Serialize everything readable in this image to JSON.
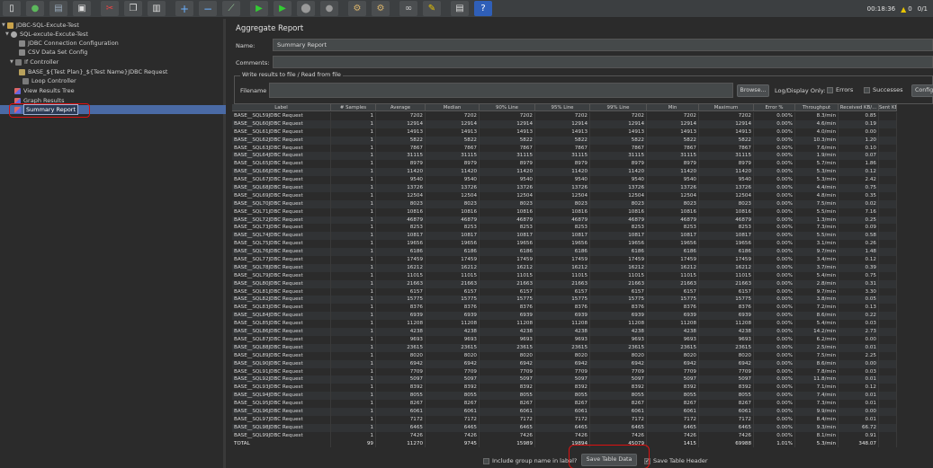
{
  "toolbar": {
    "icons": [
      "new-icon",
      "templates-icon",
      "open-icon",
      "save-icon",
      "cut-icon",
      "copy-icon",
      "paste-icon",
      "expand-icon",
      "collapse-icon",
      "toggle-icon",
      "start-icon",
      "start-no-pause-icon",
      "stop-icon",
      "shutdown-icon",
      "clear-icon",
      "clear-all-icon",
      "search-icon",
      "reset-search-icon",
      "function-helper-icon",
      "help-icon"
    ],
    "elapsed": "00:18:36",
    "warnings": "0",
    "threads": "0/1"
  },
  "tree": {
    "items": [
      {
        "label": "JDBC-SQL-Excute-Test",
        "depth": 0
      },
      {
        "label": "SQL-excute-Excute-Test",
        "depth": 1
      },
      {
        "label": "JDBC Connection Configuration",
        "depth": 2
      },
      {
        "label": "CSV Data Set Config",
        "depth": 2
      },
      {
        "label": "If Controller",
        "depth": 2
      },
      {
        "label": "BASE_${Test Plan}_${Test Name}JDBC Request",
        "depth": 3
      },
      {
        "label": "Loop Controller",
        "depth": 3
      },
      {
        "label": "View Results Tree",
        "depth": 2
      },
      {
        "label": "Graph Results",
        "depth": 2
      },
      {
        "label": "Summary Report",
        "depth": 2
      }
    ]
  },
  "panel": {
    "title": "Aggregate Report",
    "name_label": "Name:",
    "name_value": "Summary Report",
    "comments_label": "Comments:",
    "comments_value": "",
    "write_legend": "Write results to file / Read from file",
    "filename_label": "Filename",
    "filename_value": "",
    "browse_label": "Browse...",
    "log_display_label": "Log/Display Only:",
    "errors_label": "Errors",
    "successes_label": "Successes",
    "configure_label": "Configure"
  },
  "table": {
    "columns": [
      "Label",
      "# Samples",
      "Average",
      "Median",
      "90% Line",
      "95% Line",
      "99% Line",
      "Min",
      "Maximum",
      "Error %",
      "Throughput",
      "Received KB/...",
      "Sent KB/..."
    ],
    "rows": [
      [
        "BASE__SQL59JDBC Request",
        "1",
        "7202",
        "7202",
        "7202",
        "7202",
        "7202",
        "7202",
        "7202",
        "0.00%",
        "8.3/min",
        "0.85",
        ""
      ],
      [
        "BASE__SQL60JDBC Request",
        "1",
        "12914",
        "12914",
        "12914",
        "12914",
        "12914",
        "12914",
        "12914",
        "0.00%",
        "4.6/min",
        "0.19",
        ""
      ],
      [
        "BASE__SQL61JDBC Request",
        "1",
        "14913",
        "14913",
        "14913",
        "14913",
        "14913",
        "14913",
        "14913",
        "0.00%",
        "4.0/min",
        "0.00",
        ""
      ],
      [
        "BASE__SQL62JDBC Request",
        "1",
        "5822",
        "5822",
        "5822",
        "5822",
        "5822",
        "5822",
        "5822",
        "0.00%",
        "10.3/min",
        "1.20",
        ""
      ],
      [
        "BASE__SQL63JDBC Request",
        "1",
        "7867",
        "7867",
        "7867",
        "7867",
        "7867",
        "7867",
        "7867",
        "0.00%",
        "7.6/min",
        "0.10",
        ""
      ],
      [
        "BASE__SQL64JDBC Request",
        "1",
        "31115",
        "31115",
        "31115",
        "31115",
        "31115",
        "31115",
        "31115",
        "0.00%",
        "1.9/min",
        "0.07",
        ""
      ],
      [
        "BASE__SQL65JDBC Request",
        "1",
        "8979",
        "8979",
        "8979",
        "8979",
        "8979",
        "8979",
        "8979",
        "0.00%",
        "5.7/min",
        "1.86",
        ""
      ],
      [
        "BASE__SQL66JDBC Request",
        "1",
        "11420",
        "11420",
        "11420",
        "11420",
        "11420",
        "11420",
        "11420",
        "0.00%",
        "5.3/min",
        "0.12",
        ""
      ],
      [
        "BASE__SQL67JDBC Request",
        "1",
        "9540",
        "9540",
        "9540",
        "9540",
        "9540",
        "9540",
        "9540",
        "0.00%",
        "5.3/min",
        "2.42",
        ""
      ],
      [
        "BASE__SQL68JDBC Request",
        "1",
        "13726",
        "13726",
        "13726",
        "13726",
        "13726",
        "13726",
        "13726",
        "0.00%",
        "4.4/min",
        "0.75",
        ""
      ],
      [
        "BASE__SQL69JDBC Request",
        "1",
        "12504",
        "12504",
        "12504",
        "12504",
        "12504",
        "12504",
        "12504",
        "0.00%",
        "4.8/min",
        "0.35",
        ""
      ],
      [
        "BASE__SQL70JDBC Request",
        "1",
        "8023",
        "8023",
        "8023",
        "8023",
        "8023",
        "8023",
        "8023",
        "0.00%",
        "7.5/min",
        "0.02",
        ""
      ],
      [
        "BASE__SQL71JDBC Request",
        "1",
        "10816",
        "10816",
        "10816",
        "10816",
        "10816",
        "10816",
        "10816",
        "0.00%",
        "5.5/min",
        "7.16",
        ""
      ],
      [
        "BASE__SQL72JDBC Request",
        "1",
        "46879",
        "46879",
        "46879",
        "46879",
        "46879",
        "46879",
        "46879",
        "0.00%",
        "1.3/min",
        "0.25",
        ""
      ],
      [
        "BASE__SQL73JDBC Request",
        "1",
        "8253",
        "8253",
        "8253",
        "8253",
        "8253",
        "8253",
        "8253",
        "0.00%",
        "7.3/min",
        "0.09",
        ""
      ],
      [
        "BASE__SQL74JDBC Request",
        "1",
        "10817",
        "10817",
        "10817",
        "10817",
        "10817",
        "10817",
        "10817",
        "0.00%",
        "5.5/min",
        "0.58",
        ""
      ],
      [
        "BASE__SQL75JDBC Request",
        "1",
        "19656",
        "19656",
        "19656",
        "19656",
        "19656",
        "19656",
        "19656",
        "0.00%",
        "3.1/min",
        "0.26",
        ""
      ],
      [
        "BASE__SQL76JDBC Request",
        "1",
        "6186",
        "6186",
        "6186",
        "6186",
        "6186",
        "6186",
        "6186",
        "0.00%",
        "9.7/min",
        "1.48",
        ""
      ],
      [
        "BASE__SQL77JDBC Request",
        "1",
        "17459",
        "17459",
        "17459",
        "17459",
        "17459",
        "17459",
        "17459",
        "0.00%",
        "3.4/min",
        "0.12",
        ""
      ],
      [
        "BASE__SQL78JDBC Request",
        "1",
        "16212",
        "16212",
        "16212",
        "16212",
        "16212",
        "16212",
        "16212",
        "0.00%",
        "3.7/min",
        "0.39",
        ""
      ],
      [
        "BASE__SQL79JDBC Request",
        "1",
        "11015",
        "11015",
        "11015",
        "11015",
        "11015",
        "11015",
        "11015",
        "0.00%",
        "5.4/min",
        "0.75",
        ""
      ],
      [
        "BASE__SQL80JDBC Request",
        "1",
        "21663",
        "21663",
        "21663",
        "21663",
        "21663",
        "21663",
        "21663",
        "0.00%",
        "2.8/min",
        "0.31",
        ""
      ],
      [
        "BASE__SQL81JDBC Request",
        "1",
        "6157",
        "6157",
        "6157",
        "6157",
        "6157",
        "6157",
        "6157",
        "0.00%",
        "9.7/min",
        "3.30",
        ""
      ],
      [
        "BASE__SQL82JDBC Request",
        "1",
        "15775",
        "15775",
        "15775",
        "15775",
        "15775",
        "15775",
        "15775",
        "0.00%",
        "3.8/min",
        "0.05",
        ""
      ],
      [
        "BASE__SQL83JDBC Request",
        "1",
        "8376",
        "8376",
        "8376",
        "8376",
        "8376",
        "8376",
        "8376",
        "0.00%",
        "7.2/min",
        "0.13",
        ""
      ],
      [
        "BASE__SQL84JDBC Request",
        "1",
        "6939",
        "6939",
        "6939",
        "6939",
        "6939",
        "6939",
        "6939",
        "0.00%",
        "8.6/min",
        "0.22",
        ""
      ],
      [
        "BASE__SQL85JDBC Request",
        "1",
        "11208",
        "11208",
        "11208",
        "11208",
        "11208",
        "11208",
        "11208",
        "0.00%",
        "5.4/min",
        "0.03",
        ""
      ],
      [
        "BASE__SQL86JDBC Request",
        "1",
        "4238",
        "4238",
        "4238",
        "4238",
        "4238",
        "4238",
        "4238",
        "0.00%",
        "14.2/min",
        "2.73",
        ""
      ],
      [
        "BASE__SQL87JDBC Request",
        "1",
        "9693",
        "9693",
        "9693",
        "9693",
        "9693",
        "9693",
        "9693",
        "0.00%",
        "6.2/min",
        "0.00",
        ""
      ],
      [
        "BASE__SQL88JDBC Request",
        "1",
        "23615",
        "23615",
        "23615",
        "23615",
        "23615",
        "23615",
        "23615",
        "0.00%",
        "2.5/min",
        "0.01",
        ""
      ],
      [
        "BASE__SQL89JDBC Request",
        "1",
        "8020",
        "8020",
        "8020",
        "8020",
        "8020",
        "8020",
        "8020",
        "0.00%",
        "7.5/min",
        "2.25",
        ""
      ],
      [
        "BASE__SQL90JDBC Request",
        "1",
        "6942",
        "6942",
        "6942",
        "6942",
        "6942",
        "6942",
        "6942",
        "0.00%",
        "8.6/min",
        "0.00",
        ""
      ],
      [
        "BASE__SQL91JDBC Request",
        "1",
        "7709",
        "7709",
        "7709",
        "7709",
        "7709",
        "7709",
        "7709",
        "0.00%",
        "7.8/min",
        "0.03",
        ""
      ],
      [
        "BASE__SQL92JDBC Request",
        "1",
        "5097",
        "5097",
        "5097",
        "5097",
        "5097",
        "5097",
        "5097",
        "0.00%",
        "11.8/min",
        "0.01",
        ""
      ],
      [
        "BASE__SQL93JDBC Request",
        "1",
        "8392",
        "8392",
        "8392",
        "8392",
        "8392",
        "8392",
        "8392",
        "0.00%",
        "7.1/min",
        "0.12",
        ""
      ],
      [
        "BASE__SQL94JDBC Request",
        "1",
        "8055",
        "8055",
        "8055",
        "8055",
        "8055",
        "8055",
        "8055",
        "0.00%",
        "7.4/min",
        "0.01",
        ""
      ],
      [
        "BASE__SQL95JDBC Request",
        "1",
        "8267",
        "8267",
        "8267",
        "8267",
        "8267",
        "8267",
        "8267",
        "0.00%",
        "7.3/min",
        "0.01",
        ""
      ],
      [
        "BASE__SQL96JDBC Request",
        "1",
        "6061",
        "6061",
        "6061",
        "6061",
        "6061",
        "6061",
        "6061",
        "0.00%",
        "9.9/min",
        "0.00",
        ""
      ],
      [
        "BASE__SQL97JDBC Request",
        "1",
        "7172",
        "7172",
        "7172",
        "7172",
        "7172",
        "7172",
        "7172",
        "0.00%",
        "8.4/min",
        "0.01",
        ""
      ],
      [
        "BASE__SQL98JDBC Request",
        "1",
        "6465",
        "6465",
        "6465",
        "6465",
        "6465",
        "6465",
        "6465",
        "0.00%",
        "9.3/min",
        "66.72",
        ""
      ],
      [
        "BASE__SQL99JDBC Request",
        "1",
        "7426",
        "7426",
        "7426",
        "7426",
        "7426",
        "7426",
        "7426",
        "0.00%",
        "8.1/min",
        "0.91",
        ""
      ]
    ],
    "total": [
      "TOTAL",
      "99",
      "11270",
      "9745",
      "15989",
      "19894",
      "45079",
      "1415",
      "69988",
      "1.01%",
      "5.3/min",
      "348.07",
      ""
    ]
  },
  "bottom": {
    "include_group_label": "Include group name in label?",
    "save_table_data_label": "Save Table Data",
    "save_table_header_label": "Save Table Header"
  },
  "colors": {
    "background": "#2b2b2b",
    "selection": "#4a6aa5",
    "highlight": "#dd1111"
  }
}
